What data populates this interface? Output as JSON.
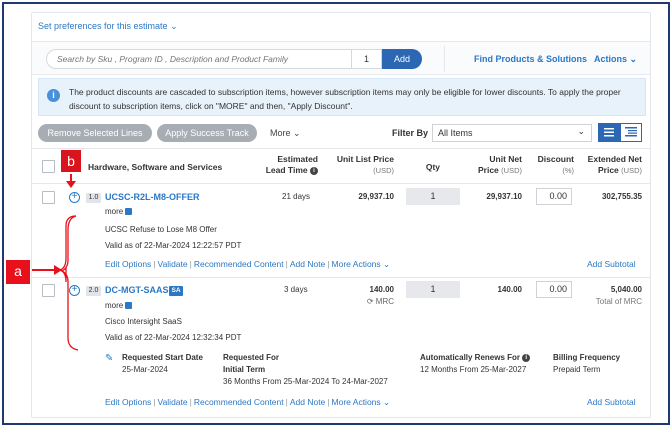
{
  "header": {
    "preferences_link": "Set preferences for this estimate",
    "search_placeholder": "Search by Sku , Program ID , Description and Product Family",
    "qty_value": "1",
    "add_button": "Add",
    "find_products": "Find Products & Solutions",
    "actions": "Actions"
  },
  "info_banner": {
    "text": "The product discounts are cascaded to subscription items, however subscription items may only be eligible for lower discounts. To apply the proper discount to subscription items, click on \"MORE\" and then, \"Apply Discount\"."
  },
  "toolbar": {
    "remove_selected": "Remove Selected Lines",
    "apply_success": "Apply Success Track",
    "more": "More",
    "filter_label": "Filter By",
    "filter_value": "All Items"
  },
  "table": {
    "headers": {
      "product": "Hardware, Software and Services",
      "lead_time_line1": "Estimated",
      "lead_time_line2": "Lead Time",
      "unit_list_price": "Unit List Price",
      "unit_list_sub": "(USD)",
      "qty": "Qty",
      "unit_net_line1": "Unit Net",
      "unit_net_line2": "Price",
      "unit_net_sub": "(USD)",
      "discount": "Discount",
      "discount_sub": "(%)",
      "extended_line1": "Extended Net",
      "extended_line2": "Price",
      "extended_sub": "(USD)"
    },
    "rows": [
      {
        "line_no": "1.0",
        "sku": "UCSC-R2L-M8-OFFER",
        "more": "more",
        "description": "UCSC Refuse to Lose M8 Offer",
        "valid": "Valid as of 22-Mar-2024 12:22:57 PDT",
        "lead_time": "21 days",
        "unit_list": "29,937.10",
        "qty": "1",
        "unit_net": "29,937.10",
        "discount": "0.00",
        "extended": "302,755.35"
      },
      {
        "line_no": "2.0",
        "sku": "DC-MGT-SAAS",
        "badge": "SA",
        "more": "more",
        "description": "Cisco Intersight SaaS",
        "valid": "Valid as of 22-Mar-2024 12:32:34 PDT",
        "lead_time": "3 days",
        "unit_list": "140.00",
        "unit_list_sub": "MRC",
        "qty": "1",
        "unit_net": "140.00",
        "discount": "0.00",
        "extended": "5,040.00",
        "extended_sub": "Total of MRC",
        "sub_details": {
          "requested_start_label": "Requested Start Date",
          "requested_start_value": "25-Mar-2024",
          "requested_for_label1": "Requested For",
          "requested_for_label2": "Initial Term",
          "requested_for_value": "36 Months From 25-Mar-2024  To 24-Mar-2027",
          "auto_renew_label": "Automatically Renews For",
          "auto_renew_value": "12 Months From 25-Mar-2027",
          "billing_label": "Billing Frequency",
          "billing_value": "Prepaid Term"
        }
      }
    ],
    "row_actions": {
      "edit": "Edit Options",
      "validate": "Validate",
      "recommended": "Recommended Content",
      "add_note": "Add Note",
      "more_actions": "More Actions",
      "add_subtotal": "Add Subtotal"
    }
  },
  "annotations": {
    "label_a": "a",
    "label_b": "b"
  },
  "colors": {
    "link": "#2b78c5",
    "primary": "#2b67b3",
    "annotation": "#e8101a"
  }
}
